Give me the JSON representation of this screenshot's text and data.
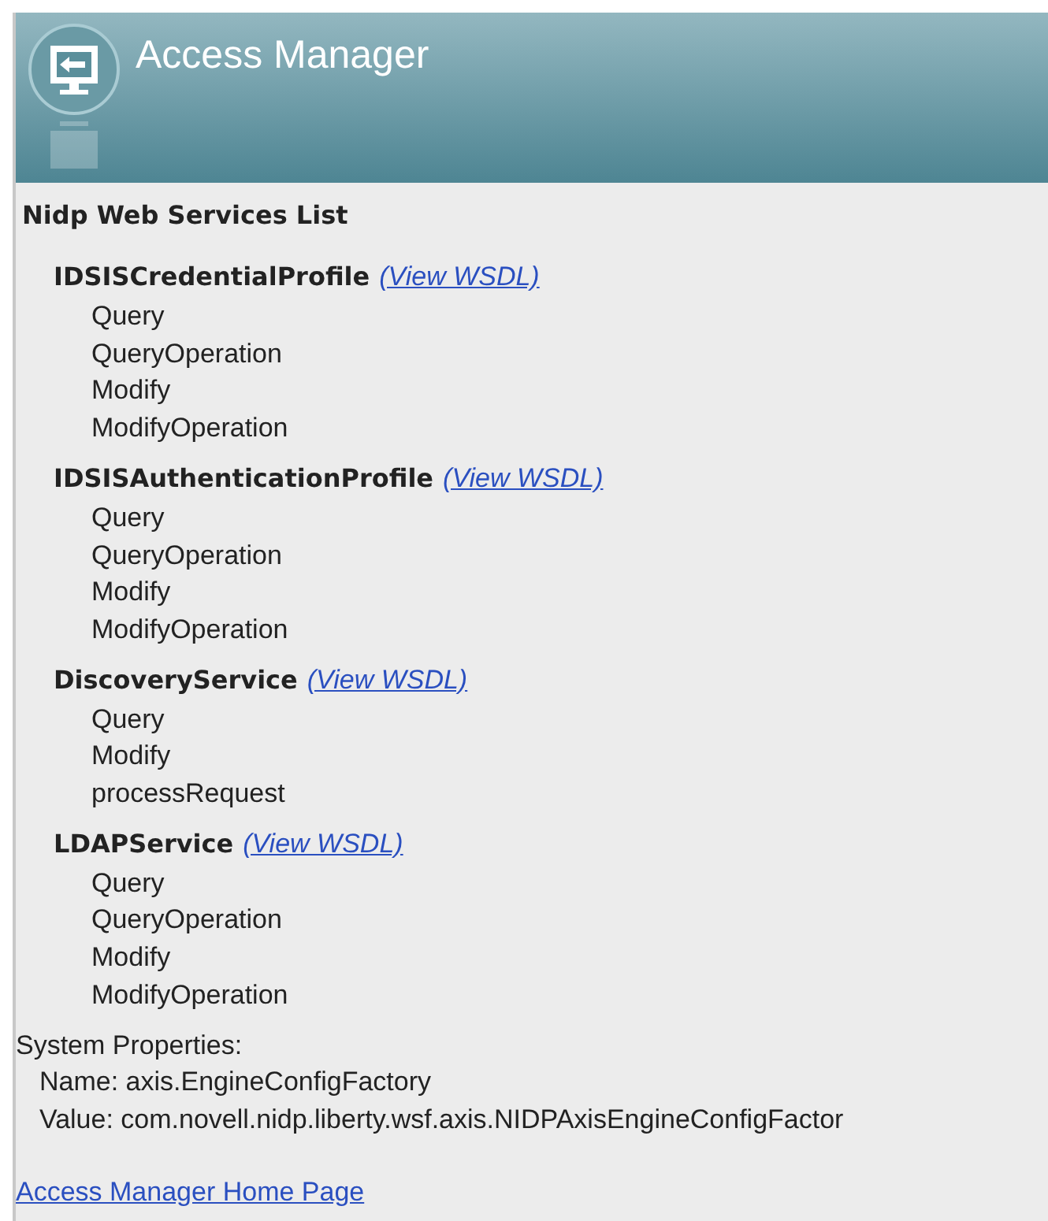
{
  "header": {
    "title": "Access Manager"
  },
  "heading": "Nidp Web Services List",
  "services": [
    {
      "name": "IDSISCredentialProfile",
      "link": "(View WSDL)",
      "operations": [
        "Query",
        "QueryOperation",
        "Modify",
        "ModifyOperation"
      ]
    },
    {
      "name": "IDSISAuthenticationProfile",
      "link": "(View WSDL)",
      "operations": [
        "Query",
        "QueryOperation",
        "Modify",
        "ModifyOperation"
      ]
    },
    {
      "name": "DiscoveryService",
      "link": "(View WSDL)",
      "operations": [
        "Query",
        "Modify",
        "processRequest"
      ]
    },
    {
      "name": "LDAPService",
      "link": "(View WSDL)",
      "operations": [
        "Query",
        "QueryOperation",
        "Modify",
        "ModifyOperation"
      ]
    }
  ],
  "system_properties": {
    "label": "System Properties:",
    "lines": [
      "Name: axis.EngineConfigFactory",
      "Value: com.novell.nidp.liberty.wsf.axis.NIDPAxisEngineConfigFactor"
    ]
  },
  "home_link": "Access Manager Home Page"
}
